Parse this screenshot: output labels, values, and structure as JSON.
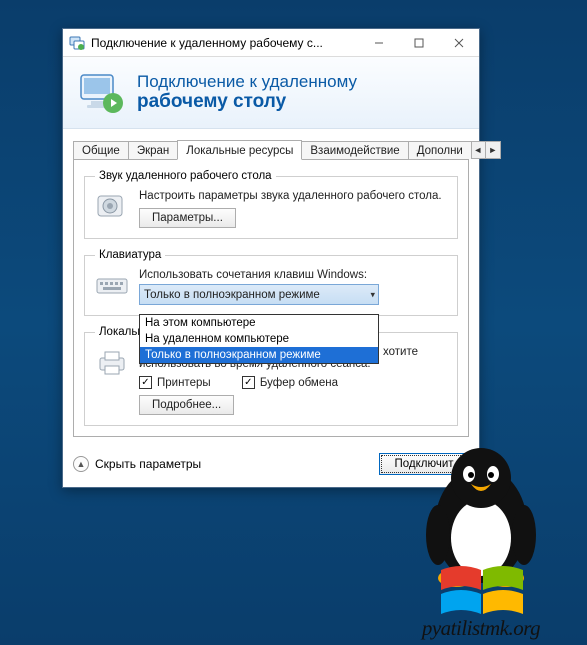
{
  "window": {
    "title": "Подключение к удаленному рабочему с..."
  },
  "banner": {
    "line1": "Подключение к удаленному",
    "line2": "рабочему столу"
  },
  "tabs": {
    "items": [
      {
        "label": "Общие"
      },
      {
        "label": "Экран"
      },
      {
        "label": "Локальные ресурсы"
      },
      {
        "label": "Взаимодействие"
      },
      {
        "label": "Дополни"
      }
    ]
  },
  "groups": {
    "audio": {
      "legend": "Звук удаленного рабочего стола",
      "text": "Настроить параметры звука удаленного рабочего стола.",
      "button": "Параметры..."
    },
    "keyboard": {
      "legend": "Клавиатура",
      "text": "Использовать сочетания клавиш Windows:",
      "selected": "Только в полноэкранном режиме",
      "options": [
        "На этом компьютере",
        "На удаленном компьютере",
        "Только в полноэкранном режиме"
      ]
    },
    "devices": {
      "legend": "Локальные устройства и ресурсы",
      "text": "Выберите устройства и ресурсы, которые вы хотите использовать во время удаленного сеанса.",
      "check_printers": "Принтеры",
      "check_clipboard": "Буфер обмена",
      "button": "Подробнее..."
    }
  },
  "footer": {
    "hide": "Скрыть параметры",
    "connect": "Подключит"
  },
  "watermark": {
    "text": "pyatilistmk.org"
  }
}
